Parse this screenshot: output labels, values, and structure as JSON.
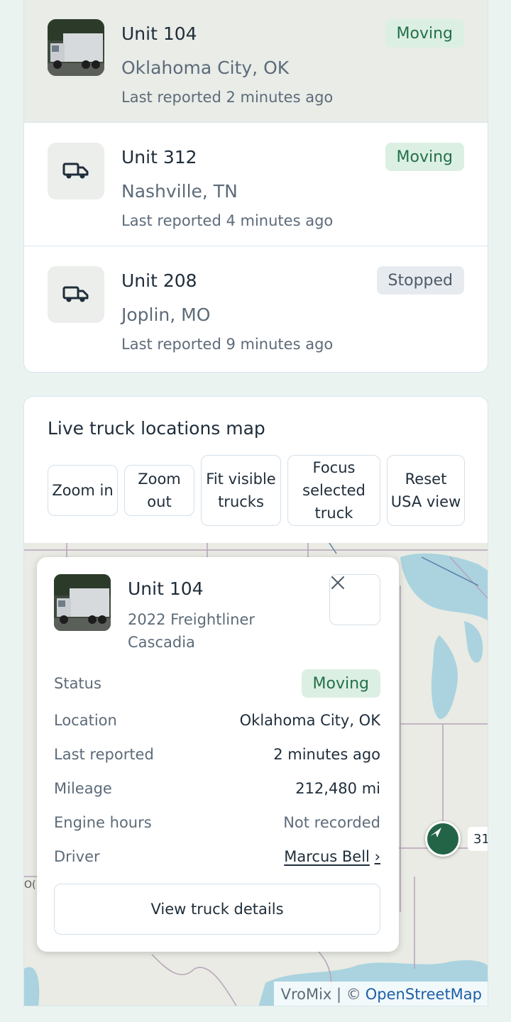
{
  "trucks": [
    {
      "unit": "Unit 104",
      "city": "Oklahoma City, OK",
      "reported": "Last reported 2 minutes ago",
      "status": "Moving",
      "thumb": "truck-photo"
    },
    {
      "unit": "Unit 312",
      "city": "Nashville, TN",
      "reported": "Last reported 4 minutes ago",
      "status": "Moving",
      "thumb": "truck-icon"
    },
    {
      "unit": "Unit 208",
      "city": "Joplin, MO",
      "reported": "Last reported 9 minutes ago",
      "status": "Stopped",
      "thumb": "truck-icon"
    }
  ],
  "map": {
    "title": "Live truck locations map",
    "controls": {
      "zoom_in": "Zoom in",
      "zoom_out": "Zoom out",
      "fit": "Fit visible trucks",
      "focus": "Focus selected truck",
      "reset": "Reset USA view"
    },
    "marker_label": "31",
    "attribution_prefix": "VroMix | ©",
    "attribution_link": "OpenStreetMap"
  },
  "popup": {
    "title": "Unit 104",
    "model": "2022 Freightliner Cascadia",
    "status_label": "Status",
    "status_value": "Moving",
    "location_label": "Location",
    "location_value": "Oklahoma City, OK",
    "reported_label": "Last reported",
    "reported_value": "2 minutes ago",
    "mileage_label": "Mileage",
    "mileage_value": "212,480 mi",
    "engine_label": "Engine hours",
    "engine_value": "Not recorded",
    "driver_label": "Driver",
    "driver_value": "Marcus Bell",
    "driver_chevron": "›",
    "view_button": "View truck details",
    "close_icon": "close-icon"
  },
  "colors": {
    "accent_green": "#236447",
    "moving_bg": "#dcefe3",
    "moving_fg": "#237049",
    "stopped_bg": "#e7ebf0",
    "page_bg": "#eaf3ef",
    "water": "#aad3df",
    "link": "#1e5fa8"
  }
}
